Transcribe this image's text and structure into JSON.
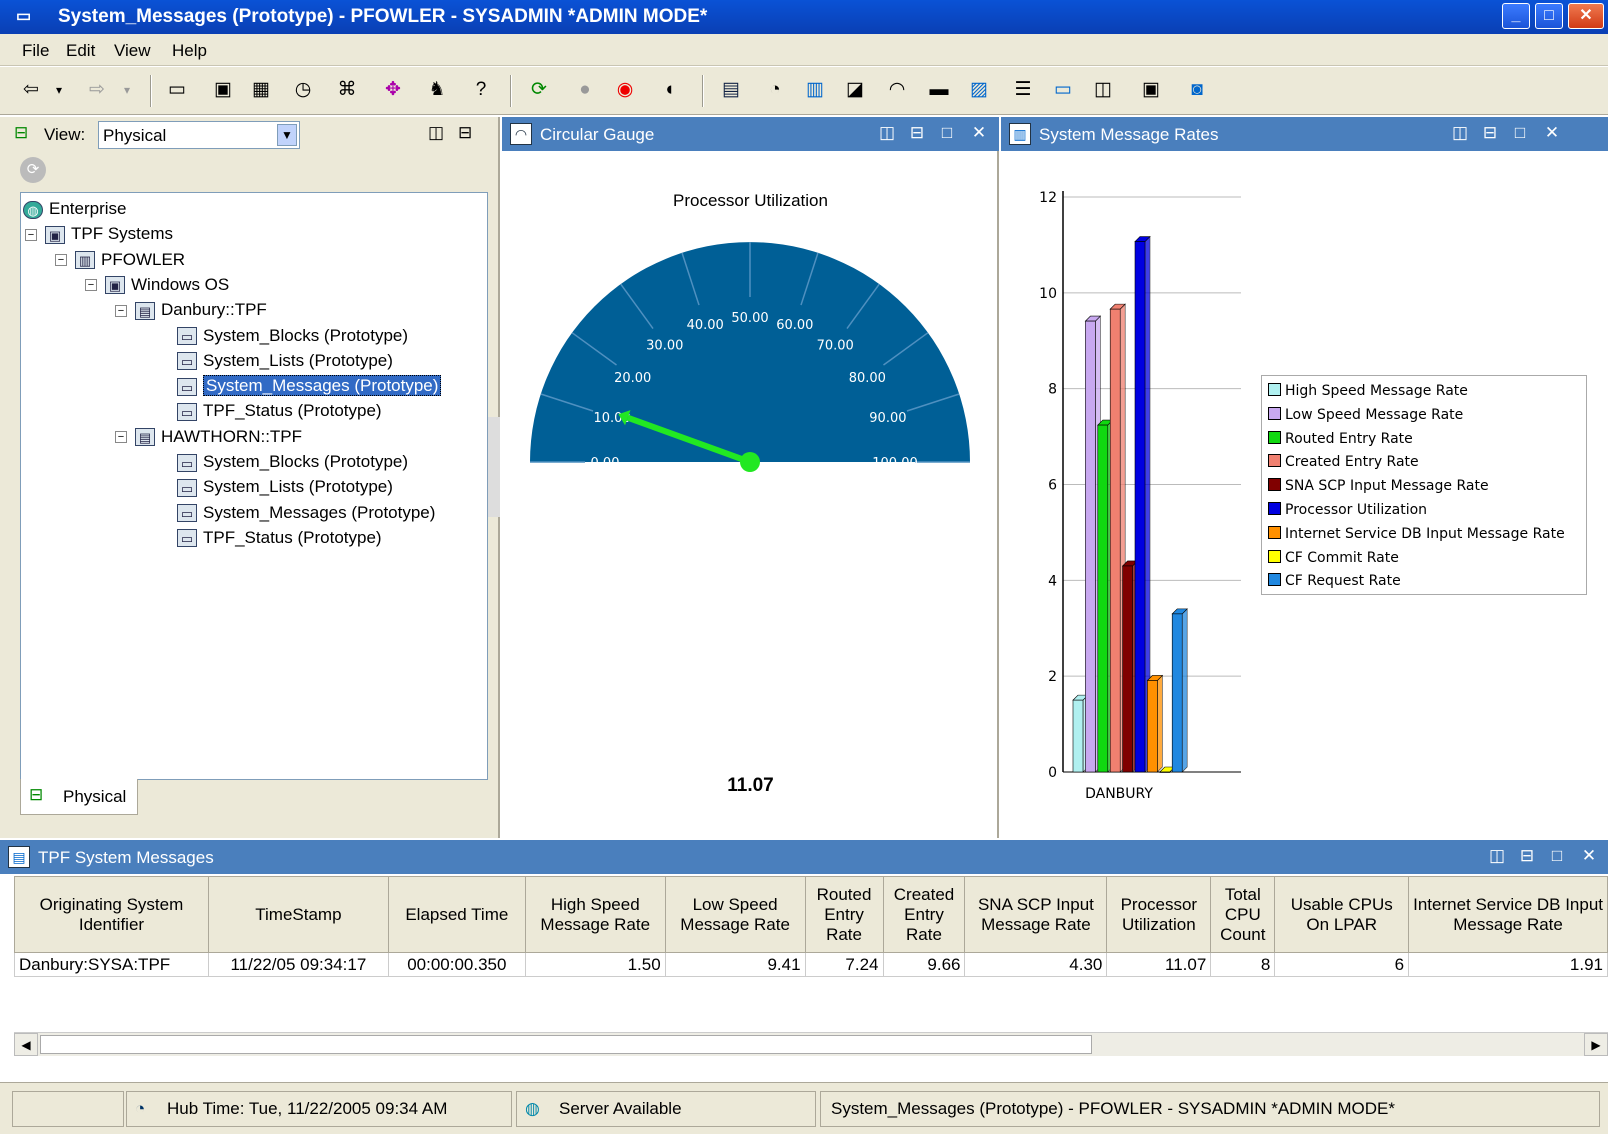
{
  "window": {
    "title": "System_Messages (Prototype) - PFOWLER - SYSADMIN  *ADMIN MODE*"
  },
  "menu": [
    "File",
    "Edit",
    "View",
    "Help"
  ],
  "navigator": {
    "view_label": "View:",
    "view_value": "Physical",
    "tab_label": "Physical",
    "tree": [
      {
        "label": "Enterprise",
        "level": 0,
        "expander": "",
        "icon": "globe-icon",
        "selected": false
      },
      {
        "label": "TPF Systems",
        "level": 1,
        "expander": "−",
        "icon": "folder-icon",
        "selected": false
      },
      {
        "label": "PFOWLER",
        "level": 2,
        "expander": "−",
        "icon": "host-icon",
        "selected": false
      },
      {
        "label": "Windows OS",
        "level": 3,
        "expander": "−",
        "icon": "folder-icon",
        "selected": false
      },
      {
        "label": "Danbury::TPF",
        "level": 4,
        "expander": "−",
        "icon": "server-icon",
        "selected": false
      },
      {
        "label": "System_Blocks (Prototype)",
        "level": 5,
        "expander": "",
        "icon": "workspace-icon",
        "selected": false
      },
      {
        "label": "System_Lists (Prototype)",
        "level": 5,
        "expander": "",
        "icon": "workspace-icon",
        "selected": false
      },
      {
        "label": "System_Messages (Prototype)",
        "level": 5,
        "expander": "",
        "icon": "workspace-icon",
        "selected": true
      },
      {
        "label": "TPF_Status (Prototype)",
        "level": 5,
        "expander": "",
        "icon": "workspace-icon",
        "selected": false
      },
      {
        "label": "HAWTHORN::TPF",
        "level": 4,
        "expander": "−",
        "icon": "server-icon",
        "selected": false
      },
      {
        "label": "System_Blocks (Prototype)",
        "level": 5,
        "expander": "",
        "icon": "workspace-icon",
        "selected": false
      },
      {
        "label": "System_Lists (Prototype)",
        "level": 5,
        "expander": "",
        "icon": "workspace-icon",
        "selected": false
      },
      {
        "label": "System_Messages (Prototype)",
        "level": 5,
        "expander": "",
        "icon": "workspace-icon",
        "selected": false
      },
      {
        "label": "TPF_Status (Prototype)",
        "level": 5,
        "expander": "",
        "icon": "workspace-icon",
        "selected": false
      }
    ]
  },
  "gauge_panel": {
    "title": "Circular Gauge",
    "gauge_title": "Processor Utilization",
    "value": 11.07,
    "value_text": "11.07",
    "min": 0,
    "max": 100,
    "ticks": [
      "0.00",
      "10.00",
      "20.00",
      "30.00",
      "40.00",
      "50.00",
      "60.00",
      "70.00",
      "80.00",
      "90.00",
      "100.00"
    ],
    "colors": {
      "dial": "#005f96",
      "needle": "#22e822"
    }
  },
  "chart_panel": {
    "title": "System Message Rates"
  },
  "chart_data": {
    "type": "bar",
    "categories": [
      "DANBURY"
    ],
    "series": [
      {
        "name": "High Speed Message Rate",
        "values": [
          1.5
        ],
        "color": "#b0f0f0"
      },
      {
        "name": "Low Speed Message Rate",
        "values": [
          9.41
        ],
        "color": "#c8a8f0"
      },
      {
        "name": "Routed Entry Rate",
        "values": [
          7.24
        ],
        "color": "#10d810"
      },
      {
        "name": "Created Entry Rate",
        "values": [
          9.66
        ],
        "color": "#f08070"
      },
      {
        "name": "SNA SCP Input Message Rate",
        "values": [
          4.3
        ],
        "color": "#800000"
      },
      {
        "name": "Processor Utilization",
        "values": [
          11.07
        ],
        "color": "#0000e0"
      },
      {
        "name": "Internet Service DB Input Message Rate",
        "values": [
          1.91
        ],
        "color": "#ff9000"
      },
      {
        "name": "CF Commit Rate",
        "values": [
          0
        ],
        "color": "#ffff00"
      },
      {
        "name": "CF Request Rate",
        "values": [
          3.3
        ],
        "color": "#2088e0"
      }
    ],
    "ylim": [
      0,
      12
    ],
    "yticks": [
      "0",
      "2",
      "4",
      "6",
      "8",
      "10",
      "12"
    ],
    "legend": "right",
    "grid": true
  },
  "table_panel": {
    "title": "TPF System Messages",
    "columns": [
      "Originating System Identifier",
      "TimeStamp",
      "Elapsed Time",
      "High Speed Message Rate",
      "Low Speed Message Rate",
      "Routed Entry Rate",
      "Created Entry Rate",
      "SNA SCP Input Message Rate",
      "Processor Utilization",
      "Total CPU Count",
      "Usable CPUs On LPAR",
      "Internet Service DB Input Message Rate"
    ],
    "rows": [
      [
        "Danbury:SYSA:TPF",
        "11/22/05 09:34:17",
        "00:00:00.350",
        "1.50",
        "9.41",
        "7.24",
        "9.66",
        "4.30",
        "11.07",
        "8",
        "6",
        "1.91"
      ]
    ]
  },
  "status": {
    "hub_time": "Hub Time: Tue, 11/22/2005 09:34 AM",
    "server": "Server Available",
    "workspace": "System_Messages (Prototype) - PFOWLER - SYSADMIN  *ADMIN MODE*"
  }
}
